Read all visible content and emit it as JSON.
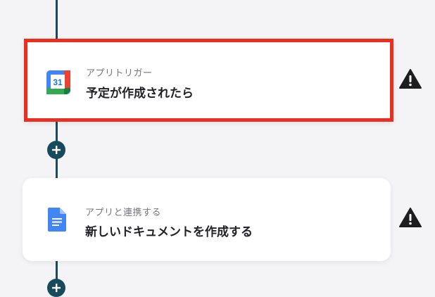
{
  "flow": {
    "steps": [
      {
        "label": "アプリトリガー",
        "title": "予定が作成されたら",
        "icon": "google-calendar-icon",
        "icon_text": "31",
        "warning_icon": "warning-triangle-icon"
      },
      {
        "label": "アプリと連携する",
        "title": "新しいドキュメントを作成する",
        "icon": "google-docs-icon",
        "warning_icon": "warning-triangle-icon"
      }
    ]
  },
  "colors": {
    "selection_border": "#ea2e1f",
    "connector": "#1b4a5a",
    "add_button": "#174a5c",
    "background": "#f4f4f6"
  }
}
